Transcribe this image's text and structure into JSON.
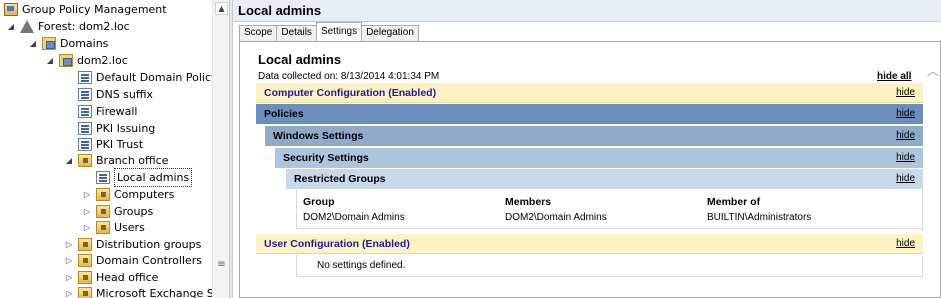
{
  "tree": {
    "items": [
      {
        "label": "Group Policy Management",
        "icon": "gpm-icon",
        "expander": ""
      },
      {
        "label": "Forest: dom2.loc",
        "icon": "forest-icon",
        "expander": "◢"
      },
      {
        "label": "Domains",
        "icon": "domains-icon",
        "expander": "◢"
      },
      {
        "label": "dom2.loc",
        "icon": "domain-icon",
        "expander": "◢"
      },
      {
        "label": "Default Domain Policy",
        "icon": "gpo-icon",
        "expander": ""
      },
      {
        "label": "DNS suffix",
        "icon": "gpo-icon",
        "expander": ""
      },
      {
        "label": "Firewall",
        "icon": "gpo-icon",
        "expander": ""
      },
      {
        "label": "PKI Issuing",
        "icon": "gpo-icon",
        "expander": ""
      },
      {
        "label": "PKI Trust",
        "icon": "gpo-icon",
        "expander": ""
      },
      {
        "label": "Branch office",
        "icon": "ou-icon",
        "expander": "◢"
      },
      {
        "label": "Local admins",
        "icon": "gpo-icon",
        "expander": "",
        "selected": true
      },
      {
        "label": "Computers",
        "icon": "ou-icon",
        "expander": "▷"
      },
      {
        "label": "Groups",
        "icon": "ou-icon",
        "expander": "▷"
      },
      {
        "label": "Users",
        "icon": "ou-icon",
        "expander": "▷"
      },
      {
        "label": "Distribution groups",
        "icon": "ou-icon",
        "expander": "▷"
      },
      {
        "label": "Domain Controllers",
        "icon": "ou-icon",
        "expander": "▷"
      },
      {
        "label": "Head office",
        "icon": "ou-icon",
        "expander": "▷"
      },
      {
        "label": "Microsoft Exchange Sec",
        "icon": "ou-icon",
        "expander": "▷"
      }
    ]
  },
  "right": {
    "title": "Local admins",
    "tabs": [
      {
        "label": "Scope"
      },
      {
        "label": "Details"
      },
      {
        "label": "Settings",
        "active": true
      },
      {
        "label": "Delegation"
      }
    ]
  },
  "report": {
    "title": "Local admins",
    "collected": "Data collected on: 8/13/2014 4:01:34 PM",
    "hide_all": "hide all",
    "computer_config": "Computer Configuration (Enabled)",
    "policies": "Policies",
    "windows_settings": "Windows Settings",
    "security_settings": "Security Settings",
    "restricted_groups": "Restricted Groups",
    "hide": "hide",
    "table": {
      "headers": [
        "Group",
        "Members",
        "Member of"
      ],
      "row": [
        "DOM2\\Domain Admins",
        "DOM2\\Domain Admins",
        "BUILTIN\\Administrators"
      ]
    },
    "user_config": "User Configuration (Enabled)",
    "no_settings": "No settings defined."
  }
}
